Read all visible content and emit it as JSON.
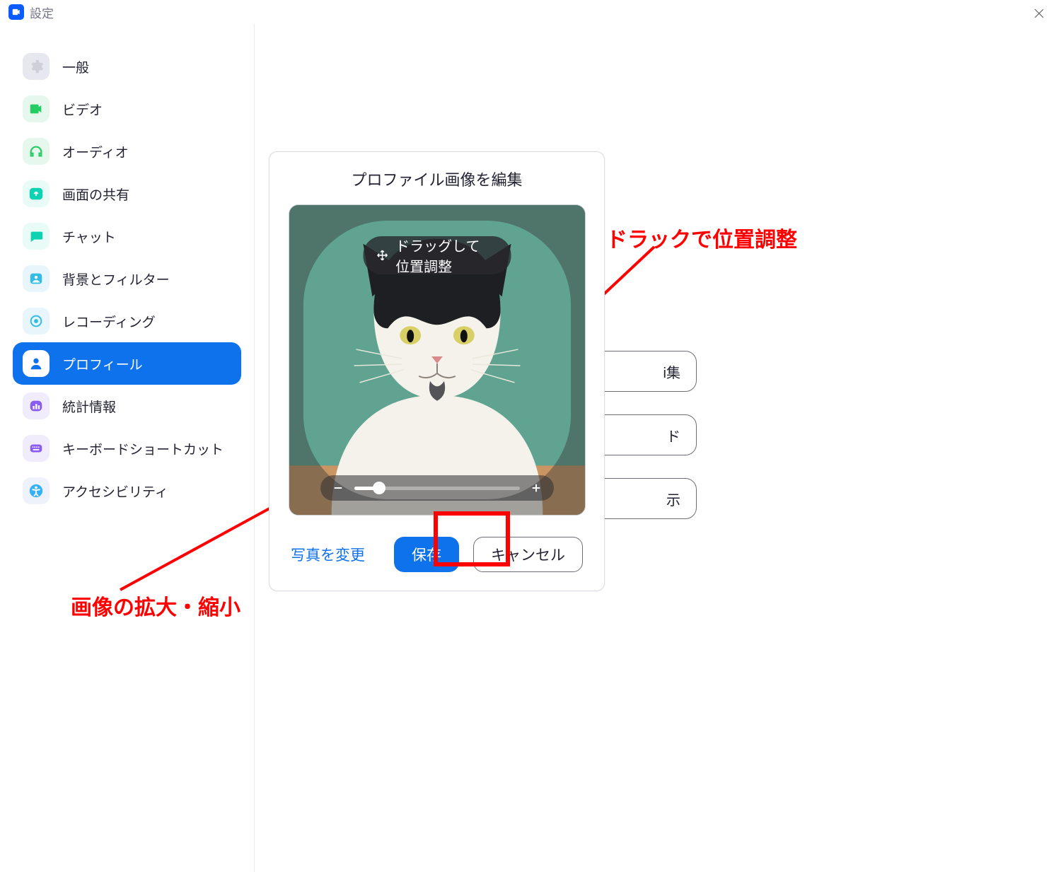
{
  "titlebar": {
    "title": "設定"
  },
  "sidebar": {
    "items": [
      {
        "label": "一般"
      },
      {
        "label": "ビデオ"
      },
      {
        "label": "オーディオ"
      },
      {
        "label": "画面の共有"
      },
      {
        "label": "チャット"
      },
      {
        "label": "背景とフィルター"
      },
      {
        "label": "レコーディング"
      },
      {
        "label": "プロフィール"
      },
      {
        "label": "統計情報"
      },
      {
        "label": "キーボードショートカット"
      },
      {
        "label": "アクセシビリティ"
      }
    ]
  },
  "main": {
    "bg_buttons": {
      "b1": "i集",
      "b2": "ド",
      "b3": "示"
    }
  },
  "dialog": {
    "title": "プロファイル画像を編集",
    "drag_hint": "ドラッグして位置調整",
    "change_photo": "写真を変更",
    "save": "保存",
    "cancel": "キャンセル"
  },
  "annotations": {
    "drag_pos": "ドラックで位置調整",
    "zoom": "画像の拡大・縮小"
  }
}
